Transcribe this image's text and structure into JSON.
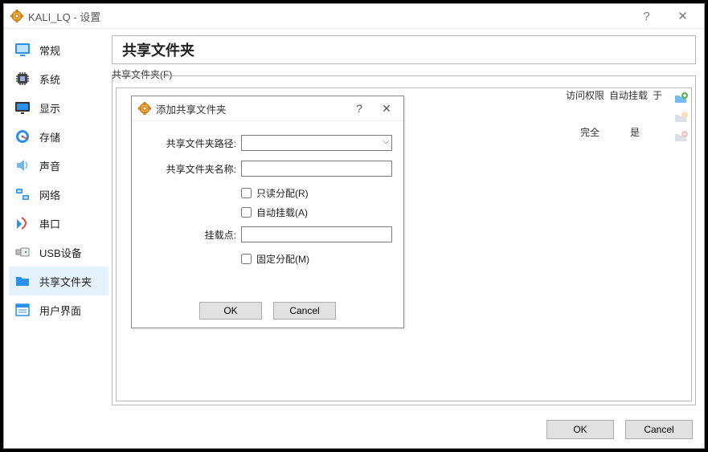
{
  "window": {
    "title": "KALI_LQ - 设置",
    "help_glyph": "?",
    "close_glyph": "✕"
  },
  "sidebar": {
    "items": [
      {
        "label": "常规",
        "icon": "monitor"
      },
      {
        "label": "系统",
        "icon": "chip"
      },
      {
        "label": "显示",
        "icon": "display"
      },
      {
        "label": "存储",
        "icon": "disk"
      },
      {
        "label": "声音",
        "icon": "speaker"
      },
      {
        "label": "网络",
        "icon": "network"
      },
      {
        "label": "串口",
        "icon": "serial"
      },
      {
        "label": "USB设备",
        "icon": "usb"
      },
      {
        "label": "共享文件夹",
        "icon": "folder",
        "selected": true
      },
      {
        "label": "用户界面",
        "icon": "ui"
      }
    ]
  },
  "panel": {
    "title": "共享文件夹",
    "fieldset_label": "共享文件夹(F)",
    "columns": {
      "access": "访问权限",
      "automount": "自动挂载",
      "at": "于"
    },
    "row": {
      "access": "完全",
      "automount": "是"
    }
  },
  "dialog": {
    "title": "添加共享文件夹",
    "help_glyph": "?",
    "close_glyph": "✕",
    "fields": {
      "path_label": "共享文件夹路径:",
      "name_label": "共享文件夹名称:",
      "readonly_label": "只读分配(R)",
      "automount_label": "自动挂载(A)",
      "mountpoint_label": "挂载点:",
      "permanent_label": "固定分配(M)"
    },
    "path_value": "",
    "name_value": "",
    "mountpoint_value": "",
    "readonly_checked": false,
    "automount_checked": false,
    "permanent_checked": false,
    "ok_label": "OK",
    "cancel_label": "Cancel"
  },
  "footer": {
    "ok_label": "OK",
    "cancel_label": "Cancel"
  }
}
